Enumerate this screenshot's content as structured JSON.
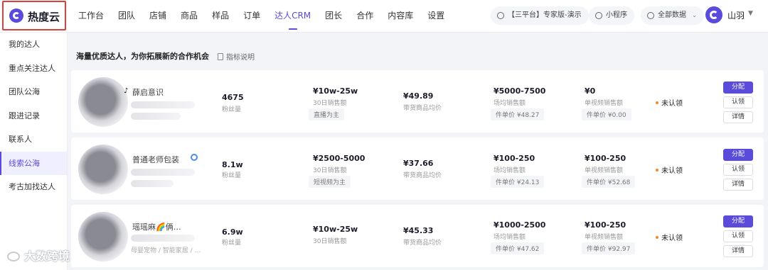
{
  "brand": {
    "name": "热度云"
  },
  "nav": {
    "items": [
      "工作台",
      "团队",
      "店铺",
      "商品",
      "样品",
      "订单",
      "达人CRM",
      "团长",
      "合作",
      "内容库",
      "设置"
    ],
    "active": "达人CRM"
  },
  "topbar": {
    "plan_label": "【三平台】专家版-演示",
    "mini_program": "小程序",
    "data_scope": "全部数据",
    "user_name": "山羽"
  },
  "sidebar": {
    "items": [
      "我的达人",
      "重点关注达人",
      "团队公海",
      "跟进记录",
      "联系人",
      "线索公海",
      "考古加找达人"
    ],
    "active": "线索公海"
  },
  "main": {
    "title": "海量优质达人，为你拓展新的合作机会",
    "metric_link": "指标说明"
  },
  "rows": [
    {
      "name": "薛启意识",
      "platform_icon": "♪",
      "followers": "4675",
      "followers_label": "粉丝量",
      "sales_30d": "¥10w-25w",
      "sales_30d_label": "30日销售额",
      "mode": "直播为主",
      "avg_price": "¥49.89",
      "avg_price_label": "带货商品均价",
      "live_sales": "¥5000-7500",
      "live_sales_label": "场均销售额",
      "live_unit": "件单价 ¥48.27",
      "video_sales": "¥0",
      "video_sales_label": "单视频销售额",
      "video_unit": "件单价 ¥0.00",
      "status": "未认领",
      "btn_assign": "分配",
      "btn_claim": "认领",
      "btn_detail": "详情"
    },
    {
      "name": "普通老师包装",
      "platform_icon": "",
      "followers": "8.1w",
      "followers_label": "粉丝量",
      "sales_30d": "¥2500-5000",
      "sales_30d_label": "30日销售额",
      "mode": "短视频为主",
      "avg_price": "¥37.66",
      "avg_price_label": "带货商品均价",
      "live_sales": "¥100-250",
      "live_sales_label": "场均销售额",
      "live_unit": "件单价 ¥24.13",
      "video_sales": "¥100-250",
      "video_sales_label": "单视频销售额",
      "video_unit": "件单价 ¥52.68",
      "status": "未认领",
      "btn_assign": "分配",
      "btn_claim": "认领",
      "btn_detail": "详情"
    },
    {
      "name": "瑶瑶麻🌈俩…",
      "platform_icon": "",
      "followers": "6.9w",
      "followers_label": "粉丝量",
      "sales_30d": "¥10w-25w",
      "sales_30d_label": "30日销售额",
      "mode": "",
      "avg_price": "¥45.33",
      "avg_price_label": "带货商品均价",
      "live_sales": "¥1000-2500",
      "live_sales_label": "场均销售额",
      "live_unit": "件单价 ¥47.62",
      "video_sales": "¥100-250",
      "video_sales_label": "单视频销售额",
      "video_unit": "件单价 ¥92.97",
      "status": "未认领",
      "category": "母婴宠物 / 智能家居 / …",
      "btn_assign": "分配",
      "btn_claim": "认领",
      "btn_detail": "详情"
    }
  ],
  "watermark": "大数跨境"
}
